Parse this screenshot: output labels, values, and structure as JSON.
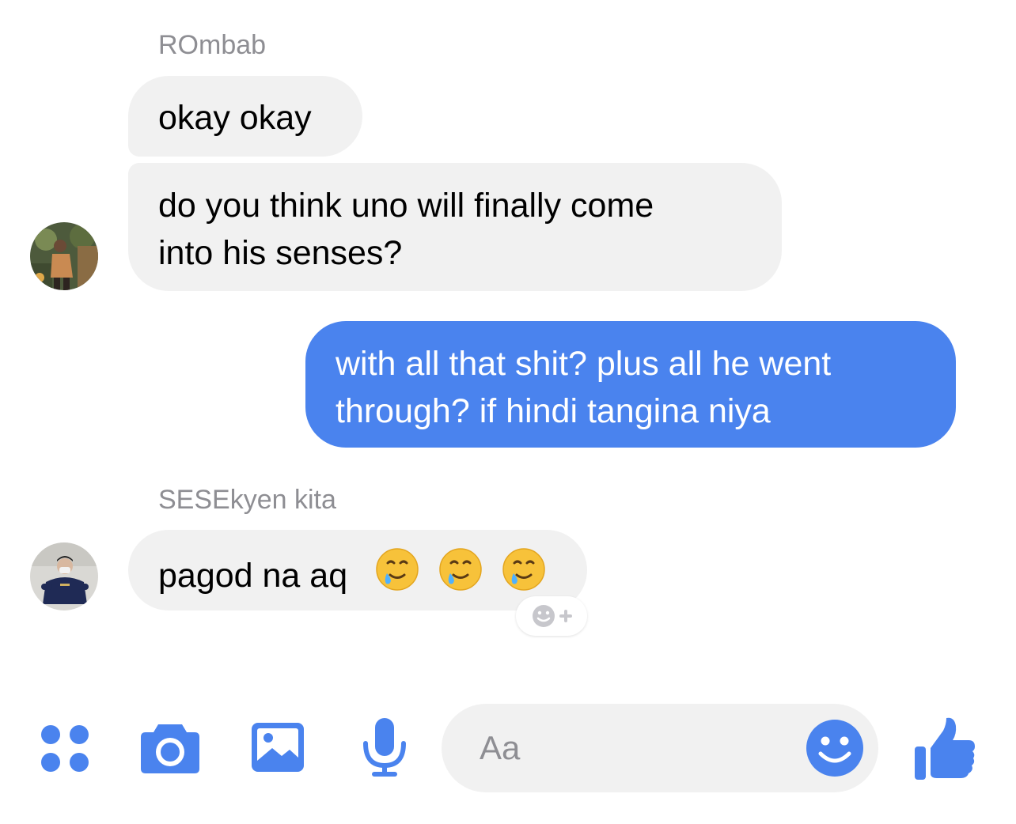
{
  "conversation": {
    "messages": [
      {
        "sender": "ROmbab",
        "text": "okay okay",
        "direction": "incoming"
      },
      {
        "text_line1": "do you think uno will finally come",
        "text_line2": "into his senses?",
        "direction": "incoming"
      },
      {
        "text_line1": "with all that shit? plus all he went",
        "text_line2": "through? if hindi tangina niya",
        "direction": "outgoing"
      },
      {
        "sender": "SESEkyen kita",
        "text": "pagod na aq",
        "emoji": [
          "smiling-face-with-tear",
          "smiling-face-with-tear",
          "smiling-face-with-tear"
        ],
        "direction": "incoming"
      }
    ]
  },
  "composer": {
    "placeholder": "Aa"
  },
  "colors": {
    "accent": "#4a83ee",
    "incoming_bubble": "#f1f1f1",
    "outgoing_bubble": "#4a83ee",
    "toolbar_icon": "#4a83ee",
    "secondary_text": "#8e8e93"
  },
  "icons": {
    "toolbar": [
      "apps-icon",
      "camera-icon",
      "gallery-icon",
      "microphone-icon"
    ],
    "composer_emoji": "emoji-icon",
    "send": "thumbs-up-icon",
    "reaction": "add-reaction-icon"
  }
}
